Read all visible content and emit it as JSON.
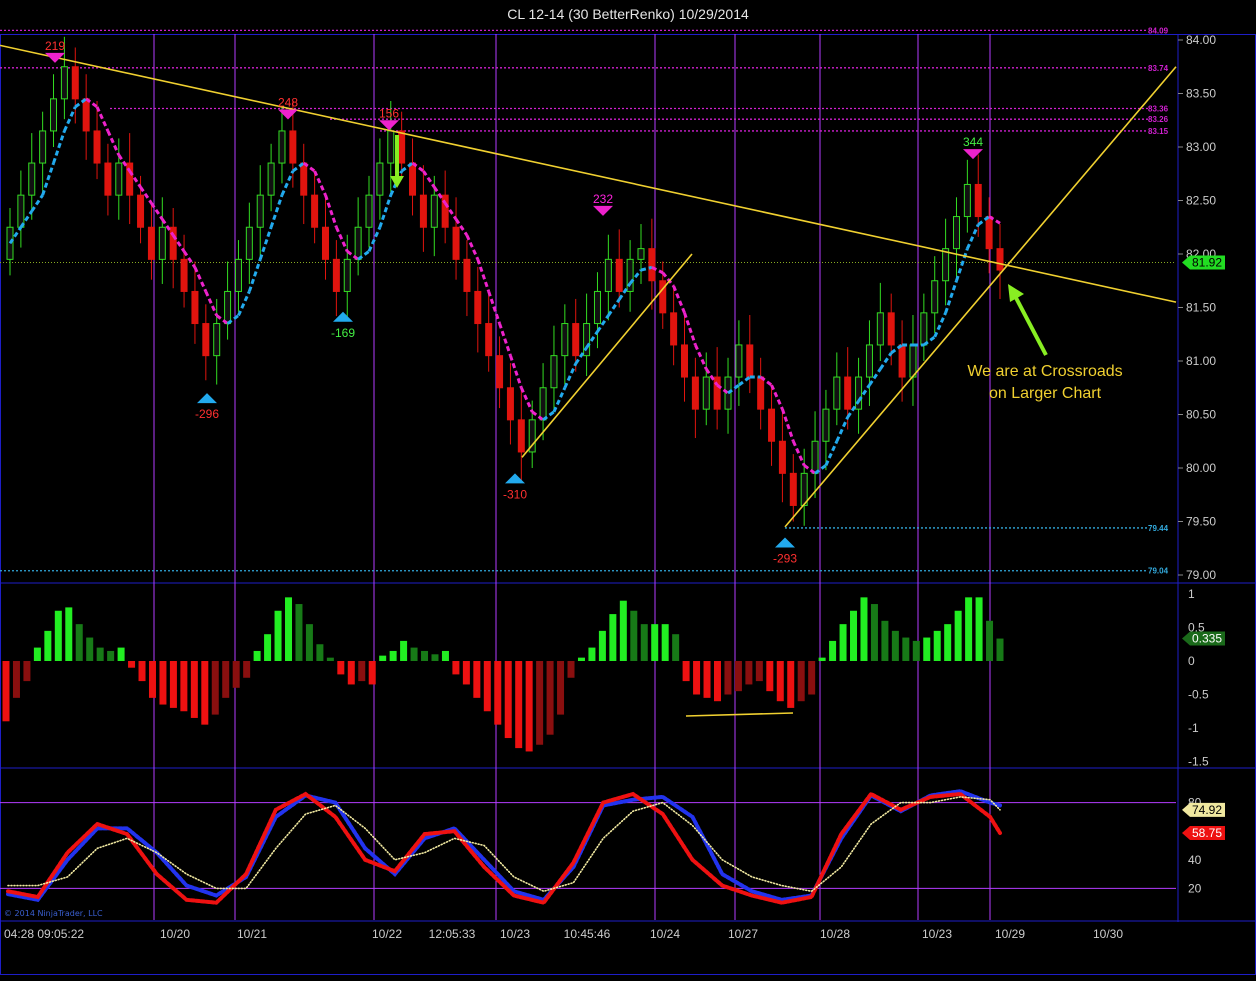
{
  "title": "CL 12-14 (30 BetterRenko)  10/29/2014",
  "watermark": "© 2014 NinjaTrader, LLC",
  "annotation": {
    "line1": "We are at Crossroads",
    "line2": "on Larger Chart"
  },
  "colors": {
    "background": "#000000",
    "separator": "#1e1ec8",
    "vline": "#b43cff",
    "bull": "#33dd22",
    "bear": "#e0140e",
    "trendline": "#f0d030",
    "arrow": "#88ee22",
    "level_magenta": "#d020d0",
    "level_blue": "#33aadd",
    "signal_up": "#22aaee",
    "signal_down": "#ee22cc"
  },
  "x_axis_labels": [
    "04:28  09:05:22",
    "10/20",
    "10/21",
    "10/22",
    "12:05:33",
    "10/23",
    "10:45:46",
    "10/24",
    "10/27",
    "10/28",
    "10/23",
    "10/29",
    "10/30"
  ],
  "chart_data": [
    {
      "name": "price",
      "type": "candlestick",
      "ylim": [
        79.0,
        84.0
      ],
      "ticks": [
        "84.00",
        "83.50",
        "83.00",
        "82.50",
        "82.00",
        "81.50",
        "81.00",
        "80.50",
        "80.00",
        "79.50",
        "79.00"
      ],
      "last_price": "81.92",
      "level_labels": [
        {
          "label": "84.09",
          "value": 84.09,
          "color": "magenta"
        },
        {
          "label": "83.74",
          "value": 83.74,
          "color": "magenta"
        },
        {
          "label": "83.36",
          "value": 83.36,
          "color": "magenta"
        },
        {
          "label": "83.26",
          "value": 83.26,
          "color": "magenta"
        },
        {
          "label": "83.15",
          "value": 83.15,
          "color": "magenta"
        },
        {
          "label": "79.44",
          "value": 79.44,
          "color": "blue"
        },
        {
          "label": "79.04",
          "value": 79.04,
          "color": "blue"
        }
      ],
      "swing_labels": [
        {
          "label": "219",
          "value": 83.88,
          "color": "red",
          "dir": "down"
        },
        {
          "label": "248",
          "value": 83.35,
          "color": "red",
          "dir": "down"
        },
        {
          "label": "156",
          "value": 83.25,
          "color": "red",
          "dir": "down"
        },
        {
          "label": "-296",
          "value": 80.7,
          "color": "red",
          "dir": "up"
        },
        {
          "label": "-169",
          "value": 81.46,
          "color": "green",
          "dir": "up"
        },
        {
          "label": "232",
          "value": 82.45,
          "color": "magenta",
          "dir": "down"
        },
        {
          "label": "-310",
          "value": 79.95,
          "color": "red",
          "dir": "up"
        },
        {
          "label": "-293",
          "value": 79.35,
          "color": "red",
          "dir": "up"
        },
        {
          "label": "344",
          "value": 82.98,
          "color": "green",
          "dir": "down"
        }
      ],
      "candles": [
        [
          81.95,
          82.25
        ],
        [
          82.25,
          82.55
        ],
        [
          82.55,
          82.85
        ],
        [
          82.85,
          83.15
        ],
        [
          83.15,
          83.45
        ],
        [
          83.45,
          83.75
        ],
        [
          83.75,
          83.45
        ],
        [
          83.45,
          83.15
        ],
        [
          83.15,
          82.85
        ],
        [
          82.85,
          82.55
        ],
        [
          82.55,
          82.85
        ],
        [
          82.85,
          82.55
        ],
        [
          82.55,
          82.25
        ],
        [
          82.25,
          81.95
        ],
        [
          81.95,
          82.25
        ],
        [
          82.25,
          81.95
        ],
        [
          81.95,
          81.65
        ],
        [
          81.65,
          81.35
        ],
        [
          81.35,
          81.05
        ],
        [
          81.05,
          81.35
        ],
        [
          81.35,
          81.65
        ],
        [
          81.65,
          81.95
        ],
        [
          81.95,
          82.25
        ],
        [
          82.25,
          82.55
        ],
        [
          82.55,
          82.85
        ],
        [
          82.85,
          83.15
        ],
        [
          83.15,
          82.85
        ],
        [
          82.85,
          82.55
        ],
        [
          82.55,
          82.25
        ],
        [
          82.25,
          81.95
        ],
        [
          81.95,
          81.65
        ],
        [
          81.65,
          81.95
        ],
        [
          81.95,
          82.25
        ],
        [
          82.25,
          82.55
        ],
        [
          82.55,
          82.85
        ],
        [
          82.85,
          83.15
        ],
        [
          83.15,
          82.85
        ],
        [
          82.85,
          82.55
        ],
        [
          82.55,
          82.25
        ],
        [
          82.25,
          82.55
        ],
        [
          82.55,
          82.25
        ],
        [
          82.25,
          81.95
        ],
        [
          81.95,
          81.65
        ],
        [
          81.65,
          81.35
        ],
        [
          81.35,
          81.05
        ],
        [
          81.05,
          80.75
        ],
        [
          80.75,
          80.45
        ],
        [
          80.45,
          80.15
        ],
        [
          80.15,
          80.45
        ],
        [
          80.45,
          80.75
        ],
        [
          80.75,
          81.05
        ],
        [
          81.05,
          81.35
        ],
        [
          81.35,
          81.05
        ],
        [
          81.05,
          81.35
        ],
        [
          81.35,
          81.65
        ],
        [
          81.65,
          81.95
        ],
        [
          81.95,
          81.65
        ],
        [
          81.65,
          81.95
        ],
        [
          81.95,
          82.05
        ],
        [
          82.05,
          81.75
        ],
        [
          81.75,
          81.45
        ],
        [
          81.45,
          81.15
        ],
        [
          81.15,
          80.85
        ],
        [
          80.85,
          80.55
        ],
        [
          80.55,
          80.85
        ],
        [
          80.85,
          80.55
        ],
        [
          80.55,
          80.85
        ],
        [
          80.85,
          81.15
        ],
        [
          81.15,
          80.85
        ],
        [
          80.85,
          80.55
        ],
        [
          80.55,
          80.25
        ],
        [
          80.25,
          79.95
        ],
        [
          79.95,
          79.65
        ],
        [
          79.65,
          79.95
        ],
        [
          79.95,
          80.25
        ],
        [
          80.25,
          80.55
        ],
        [
          80.55,
          80.85
        ],
        [
          80.85,
          80.55
        ],
        [
          80.55,
          80.85
        ],
        [
          80.85,
          81.15
        ],
        [
          81.15,
          81.45
        ],
        [
          81.45,
          81.15
        ],
        [
          81.15,
          80.85
        ],
        [
          80.85,
          81.15
        ],
        [
          81.15,
          81.45
        ],
        [
          81.45,
          81.75
        ],
        [
          81.75,
          82.05
        ],
        [
          82.05,
          82.35
        ],
        [
          82.35,
          82.65
        ],
        [
          82.65,
          82.35
        ],
        [
          82.35,
          82.05
        ],
        [
          82.05,
          81.85
        ]
      ]
    },
    {
      "name": "oscillator",
      "type": "histogram",
      "ylim": [
        -1.5,
        1.1
      ],
      "ticks": [
        "1",
        "0.5",
        "0",
        "-0.5",
        "-1",
        "-1.5"
      ],
      "last_value": "0.335",
      "values": [
        -0.9,
        -0.55,
        -0.3,
        0.2,
        0.45,
        0.75,
        0.8,
        0.55,
        0.35,
        0.2,
        0.15,
        0.2,
        -0.1,
        -0.3,
        -0.55,
        -0.65,
        -0.7,
        -0.75,
        -0.85,
        -0.95,
        -0.8,
        -0.55,
        -0.4,
        -0.25,
        0.15,
        0.4,
        0.75,
        0.95,
        0.85,
        0.55,
        0.25,
        0.05,
        -0.2,
        -0.35,
        -0.3,
        -0.35,
        0.08,
        0.15,
        0.3,
        0.2,
        0.15,
        0.1,
        0.15,
        -0.2,
        -0.35,
        -0.55,
        -0.75,
        -0.95,
        -1.15,
        -1.3,
        -1.35,
        -1.25,
        -1.1,
        -0.8,
        -0.25,
        0.05,
        0.2,
        0.45,
        0.7,
        0.9,
        0.75,
        0.55,
        0.55,
        0.55,
        0.4,
        -0.3,
        -0.5,
        -0.55,
        -0.6,
        -0.5,
        -0.45,
        -0.35,
        -0.3,
        -0.45,
        -0.6,
        -0.7,
        -0.6,
        -0.5,
        0.05,
        0.3,
        0.55,
        0.75,
        0.95,
        0.85,
        0.6,
        0.45,
        0.35,
        0.3,
        0.35,
        0.45,
        0.55,
        0.75,
        0.95,
        0.95,
        0.6,
        0.335
      ]
    },
    {
      "name": "stochastic",
      "type": "line",
      "ylim": [
        0,
        100
      ],
      "ticks": [
        "80",
        "60",
        "40",
        "20"
      ],
      "k_last": "58.75",
      "d_last": "74.92",
      "series": [
        {
          "color": "blue",
          "x": [
            0,
            0.03,
            0.06,
            0.09,
            0.12,
            0.15,
            0.18,
            0.21,
            0.24,
            0.27,
            0.3,
            0.33,
            0.36,
            0.39,
            0.42,
            0.45,
            0.48,
            0.51,
            0.54,
            0.57,
            0.6,
            0.63,
            0.66,
            0.69,
            0.72,
            0.75,
            0.78,
            0.81,
            0.84,
            0.87,
            0.9,
            0.93,
            0.96,
            0.99,
            1.0
          ],
          "values": [
            16,
            12,
            40,
            62,
            62,
            45,
            22,
            15,
            28,
            70,
            85,
            80,
            48,
            30,
            55,
            62,
            40,
            18,
            12,
            35,
            78,
            82,
            84,
            70,
            30,
            18,
            12,
            15,
            55,
            85,
            74,
            85,
            88,
            80,
            78
          ]
        },
        {
          "color": "red",
          "x": [
            0,
            0.03,
            0.06,
            0.09,
            0.12,
            0.15,
            0.18,
            0.21,
            0.24,
            0.27,
            0.3,
            0.33,
            0.36,
            0.39,
            0.42,
            0.45,
            0.48,
            0.51,
            0.54,
            0.57,
            0.6,
            0.63,
            0.66,
            0.69,
            0.72,
            0.75,
            0.78,
            0.81,
            0.84,
            0.87,
            0.9,
            0.93,
            0.96,
            0.99,
            1.0
          ],
          "values": [
            18,
            14,
            45,
            65,
            58,
            30,
            12,
            10,
            30,
            75,
            86,
            70,
            40,
            32,
            58,
            60,
            35,
            15,
            10,
            38,
            80,
            86,
            72,
            40,
            22,
            15,
            10,
            14,
            58,
            86,
            75,
            84,
            86,
            70,
            58.75
          ]
        },
        {
          "color": "yellow",
          "x": [
            0,
            0.03,
            0.06,
            0.09,
            0.12,
            0.15,
            0.18,
            0.21,
            0.24,
            0.27,
            0.3,
            0.33,
            0.36,
            0.39,
            0.42,
            0.45,
            0.48,
            0.51,
            0.54,
            0.57,
            0.6,
            0.63,
            0.66,
            0.69,
            0.72,
            0.75,
            0.78,
            0.81,
            0.84,
            0.87,
            0.9,
            0.93,
            0.96,
            0.99,
            1.0
          ],
          "values": [
            22,
            22,
            28,
            48,
            55,
            45,
            30,
            20,
            20,
            48,
            72,
            78,
            62,
            40,
            45,
            55,
            50,
            28,
            18,
            24,
            55,
            74,
            80,
            64,
            40,
            28,
            22,
            18,
            35,
            65,
            80,
            80,
            84,
            82,
            74.92
          ]
        }
      ]
    }
  ]
}
